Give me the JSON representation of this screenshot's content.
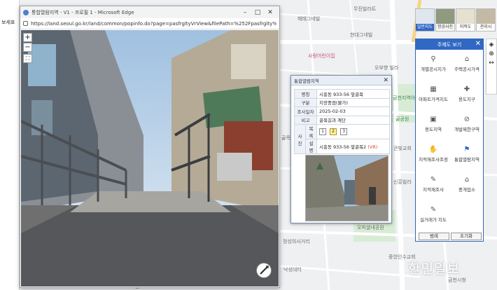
{
  "left_strip": {
    "tab_label": "보세표"
  },
  "popup": {
    "window_title": "통합열람지역 - V1 - 프로필 1 - Microsoft Edge",
    "url": "https://land.seoul.go.kr/land/common/popinfo.do?page=pasfrgltyVrView&filePath=%252Fpasfrglty%252f11545%..."
  },
  "info": {
    "title": "통합열람지역",
    "rows": [
      {
        "key": "명칭",
        "value": "시흥동 933-56 앞골목"
      },
      {
        "key": "구분",
        "value": "지장중점(불가)"
      },
      {
        "key": "조사일자",
        "value": "2025-02-03"
      },
      {
        "key": "비고",
        "value": "골목길과 계단"
      }
    ],
    "photo_label": "사진",
    "list_label": "목록",
    "desc_label": "설명",
    "photo_buttons": [
      "1",
      "2",
      "3"
    ],
    "selected_photo": "2",
    "desc_value": "시흥동 933-56 앞골목2",
    "vr_tag": "(VR)"
  },
  "map_types": [
    {
      "label": "일반지도",
      "selected": true
    },
    {
      "label": "항공사진",
      "selected": false
    },
    {
      "label": "지적도",
      "selected": false
    },
    {
      "label": "관리시",
      "selected": false
    }
  ],
  "theme_panel": {
    "title": "주제도 보기",
    "items": [
      {
        "label": "개별공시지가",
        "icon": "person-pin-icon"
      },
      {
        "label": "주택공시가격",
        "icon": "house-price-icon"
      },
      {
        "label": "아파트가격지도",
        "icon": "apartment-icon"
      },
      {
        "label": "용도지구",
        "icon": "grid-cross-icon"
      },
      {
        "label": "용도지역",
        "icon": "frame-icon"
      },
      {
        "label": "개발제한구역",
        "icon": "restriction-icon"
      },
      {
        "label": "지적재조사조정",
        "icon": "hand-icon"
      },
      {
        "label": "통합열람지역",
        "icon": "flag-icon"
      },
      {
        "label": "지적재조사",
        "icon": "pen-icon"
      },
      {
        "label": "중개업소",
        "icon": "office-icon"
      },
      {
        "label": "실거래가 지도",
        "icon": "pen-map-icon"
      }
    ],
    "close_label": "범례",
    "reset_label": "초기화"
  },
  "map_labels": [
    "무진빌라트",
    "해태그네빌",
    "현대그네빌",
    "사랑어린이집",
    "오부향 빌라",
    "금천지역아동센터",
    "골공원",
    "골목길",
    "큰빛교회",
    "신흥빌라",
    "오피셜내공원",
    "중앙인수교회",
    "정성의사거리",
    "낙성대터",
    "금천시청",
    "교보문고"
  ],
  "watermark": "한민일보"
}
